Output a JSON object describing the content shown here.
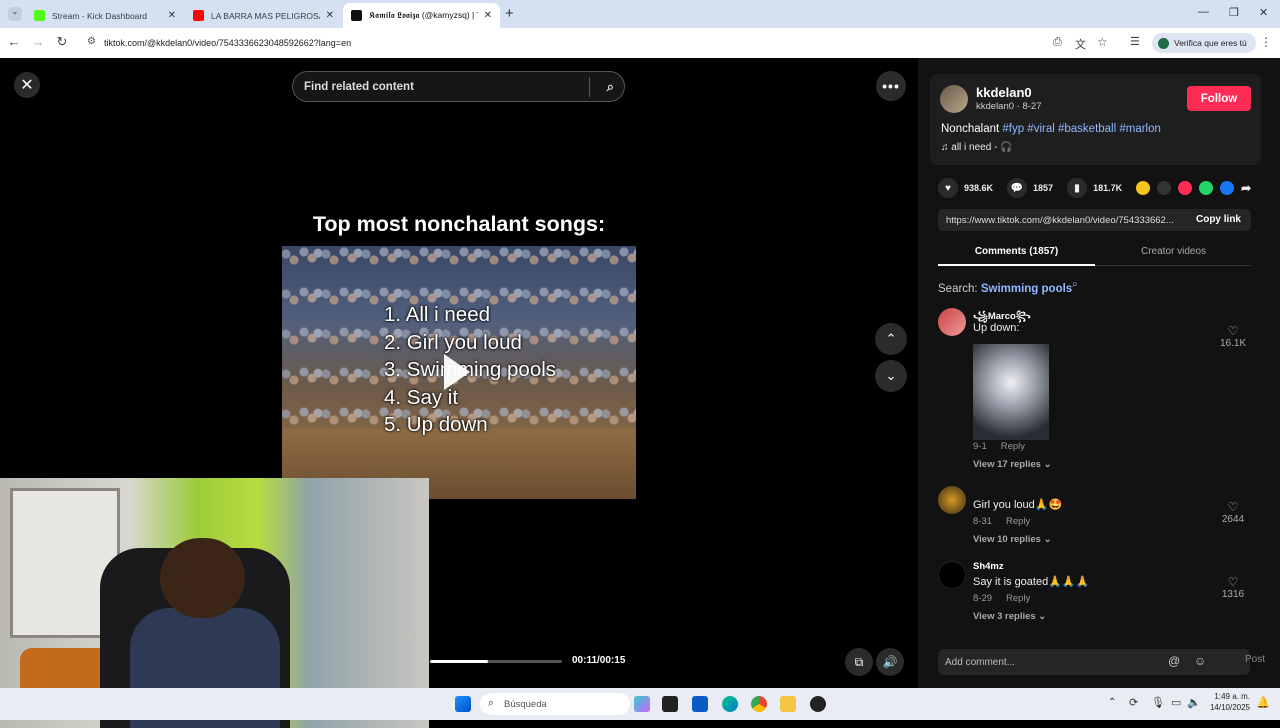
{
  "browser": {
    "tabs": [
      {
        "title": "Stream - Kick Dashboard",
        "color": "#53fc18"
      },
      {
        "title": "LA BARRA MAS PELIGROSA DE",
        "color": "#ff0000"
      },
      {
        "title": "𝕶𝖆𝖒𝖎𝖑𝖆 𝕷𝖔𝖆𝖎𝖟𝖆 (@kamyzsq) | T",
        "color": "#111111"
      }
    ],
    "new_tab": "+",
    "url": "tiktok.com/@kkdelan0/video/7543336623048592662?lang=en",
    "verify_label": "Verifica que eres tú"
  },
  "video": {
    "search_placeholder": "Find related content",
    "title": "Top most nonchalant songs:",
    "list": [
      "1. All i need",
      "2. Girl you loud",
      "3. Swimming pools",
      "4. Say it",
      "5. Up down"
    ],
    "progress": 0.44,
    "time": "00:11/00:15"
  },
  "author": {
    "name": "kkdelan0",
    "handle_date": "kkdelan0 · 8-27",
    "follow_label": "Follow",
    "description_prefix": "Nonchalant ",
    "hashtags": "#fyp #viral #basketball #marlon",
    "music": "♫  all i need - 🎧"
  },
  "stats": {
    "likes": "938.6K",
    "comments": "1857",
    "saves": "181.7K"
  },
  "share": {
    "link": "https://www.tiktok.com/@kkdelan0/video/754333662...",
    "copy_label": "Copy link"
  },
  "panel_tabs": {
    "comments": "Comments (1857)",
    "creator": "Creator videos"
  },
  "comment_search": {
    "prefix": "Search: ",
    "term": "Swimming pools"
  },
  "comments": [
    {
      "name": "꧁Marco꧂",
      "text": "Up down:",
      "date": "9-1",
      "reply": "Reply",
      "replies": "View 17 replies ⌄",
      "likes": "16.1K"
    },
    {
      "name": "",
      "text": "Girl you loud🙏🤩",
      "date": "8-31",
      "reply": "Reply",
      "replies": "View 10 replies ⌄",
      "likes": "2644"
    },
    {
      "name": "Sh4mz",
      "text": "Say it is goated🙏🙏🙏",
      "date": "8-29",
      "reply": "Reply",
      "replies": "View 3 replies ⌄",
      "likes": "1316"
    }
  ],
  "add_comment": {
    "placeholder": "Add comment...",
    "post": "Post"
  },
  "taskbar": {
    "search": "Búsqueda",
    "time": "1:49 a. m.",
    "date": "14/10/2025"
  },
  "colors": {
    "follow": "#fe2c55",
    "hashtag": "#8fb8ff",
    "accent_tab": "#d6e0f3"
  }
}
